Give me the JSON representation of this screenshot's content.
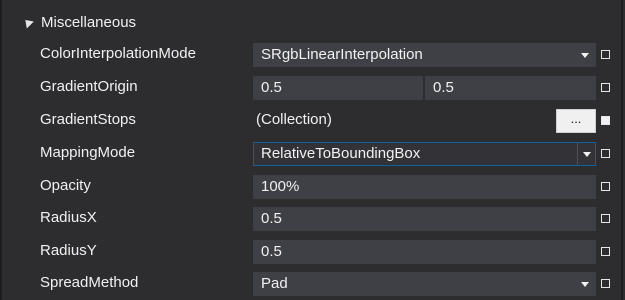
{
  "category": {
    "label": "Miscellaneous",
    "icon": "collapse-arrow-icon"
  },
  "properties": [
    {
      "name": "ColorInterpolationMode",
      "value": "SRgbLinearInterpolation",
      "kind": "combo"
    },
    {
      "name": "GradientOrigin",
      "value_x": "0.5",
      "value_y": "0.5",
      "kind": "pair"
    },
    {
      "name": "GradientStops",
      "value": "(Collection)",
      "button": "...",
      "kind": "collection"
    },
    {
      "name": "MappingMode",
      "value": "RelativeToBoundingBox",
      "kind": "combo-active"
    },
    {
      "name": "Opacity",
      "value": "100%",
      "kind": "text"
    },
    {
      "name": "RadiusX",
      "value": "0.5",
      "kind": "text"
    },
    {
      "name": "RadiusY",
      "value": "0.5",
      "kind": "text"
    },
    {
      "name": "SpreadMethod",
      "value": "Pad",
      "kind": "combo"
    }
  ],
  "colors": {
    "background": "#2d2d30",
    "field": "#3f3f46",
    "accent": "#0e639c",
    "text": "#f1f1f1"
  }
}
